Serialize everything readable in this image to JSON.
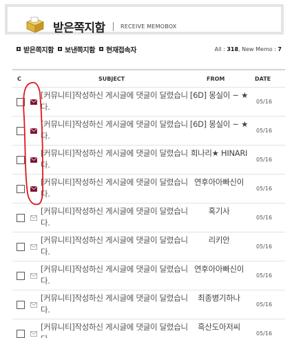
{
  "header": {
    "title": "받은쪽지함",
    "subtitle": "RECEIVE MEMOBOX"
  },
  "nav": {
    "items": [
      {
        "label": "받은쪽지함"
      },
      {
        "label": "보낸쪽지함"
      },
      {
        "label": "현재접속자"
      }
    ]
  },
  "summary": {
    "all_label": "All :",
    "all_count": "318",
    "new_label": ", New Memo :",
    "new_count": "7"
  },
  "table": {
    "columns": {
      "check": "C",
      "subject": "SUBJECT",
      "from": "FROM",
      "date": "DATE"
    },
    "rows": [
      {
        "subject": "[커뮤니티]작성하신 게시글에 댓글이 달렸습니다.",
        "from": "[6D] 몽실이 ~ ★",
        "date": "05/16",
        "unread": true
      },
      {
        "subject": "[커뮤니티]작성하신 게시글에 댓글이 달렸습니다.",
        "from": "[6D] 몽실이 ~ ★",
        "date": "05/16",
        "unread": true
      },
      {
        "subject": "[커뮤니티]작성하신 게시글에 댓글이 달렸습니다.",
        "from": "희나리★ HINARI",
        "date": "05/16",
        "unread": true
      },
      {
        "subject": "[커뮤니티]작성하신 게시글에 댓글이 달렸습니다.",
        "from": "연후아아빠신이",
        "date": "05/16",
        "unread": true
      },
      {
        "subject": "[커뮤니티]작성하신 게시글에 댓글이 달렸습니다.",
        "from": "혹기사",
        "date": "05/16",
        "unread": false
      },
      {
        "subject": "[커뮤니티]작성하신 게시글에 댓글이 달렸습니다.",
        "from": "리키안",
        "date": "05/16",
        "unread": false
      },
      {
        "subject": "[커뮤니티]작성하신 게시글에 댓글이 달렸습니다.",
        "from": "연후아아빠신이",
        "date": "05/16",
        "unread": false
      },
      {
        "subject": "[커뮤니티]작성하신 게시글에 댓글이 달렸습니다.",
        "from": "최종병기하나",
        "date": "05/16",
        "unread": false
      },
      {
        "subject": "[커뮤니티]작성하신 게시글에 댓글이 달렸습니다.",
        "from": "흑산도아저씨",
        "date": "05/16",
        "unread": false
      }
    ]
  },
  "colors": {
    "unread_mail": "#7a1030",
    "read_mail": "#9a9a9a",
    "annotation": "#e0141b"
  },
  "icons": {
    "header": "memo-box-icon",
    "nav_bullet": "arrow-bullet-icon",
    "unread": "unread-mail-icon",
    "read": "read-mail-icon"
  }
}
